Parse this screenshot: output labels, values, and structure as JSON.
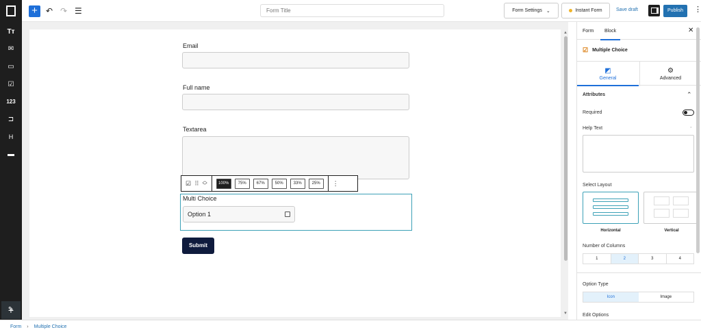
{
  "topbar": {
    "form_title_placeholder": "Form Title",
    "form_settings_label": "Form Settings",
    "instant_form_label": "Instant Form",
    "save_draft_label": "Save draft",
    "publish_label": "Publish"
  },
  "sidebar": {
    "items": [
      {
        "icon": "text-format-icon",
        "glyph": "Tт"
      },
      {
        "icon": "email-icon",
        "glyph": "✉"
      },
      {
        "icon": "input-field-icon",
        "glyph": "▭"
      },
      {
        "icon": "checkbox-icon",
        "glyph": "☑"
      },
      {
        "icon": "number-icon",
        "glyph": "123"
      },
      {
        "icon": "button-icon",
        "glyph": "⊐"
      },
      {
        "icon": "heading-icon",
        "glyph": "H"
      },
      {
        "icon": "card-icon",
        "glyph": "▬"
      }
    ]
  },
  "form": {
    "fields": [
      {
        "label": "Email"
      },
      {
        "label": "Full name"
      },
      {
        "label": "Textarea"
      }
    ],
    "width_options": [
      "100%",
      "75%",
      "67%",
      "50%",
      "33%",
      "25%"
    ],
    "active_width": "100%",
    "multi_choice_label": "Multi Choice",
    "option_1": "Option 1",
    "submit_label": "Submit"
  },
  "panel": {
    "tabs": [
      "Form",
      "Block"
    ],
    "active_tab": "Block",
    "block_name": "Multiple Choice",
    "subtabs": [
      "General",
      "Advanced"
    ],
    "attributes_label": "Attributes",
    "required_label": "Required",
    "help_text_label": "Help Text",
    "select_layout_label": "Select Layout",
    "layout_options": [
      "Horizontal",
      "Vertical"
    ],
    "selected_layout": "Horizontal",
    "columns_label": "Number of Columns",
    "columns": [
      "1",
      "2",
      "3",
      "4"
    ],
    "selected_columns": "2",
    "option_type_label": "Option Type",
    "option_types": [
      "Icon",
      "Image"
    ],
    "selected_option_type": "Icon",
    "edit_options_label": "Edit Options"
  },
  "breadcrumb": {
    "root": "Form",
    "separator": "›",
    "current": "Multiple Choice"
  },
  "colors": {
    "accent": "#1e6fd9",
    "selected_block_border": "#3aa0b6",
    "submit_bg": "#0f1b3d"
  }
}
